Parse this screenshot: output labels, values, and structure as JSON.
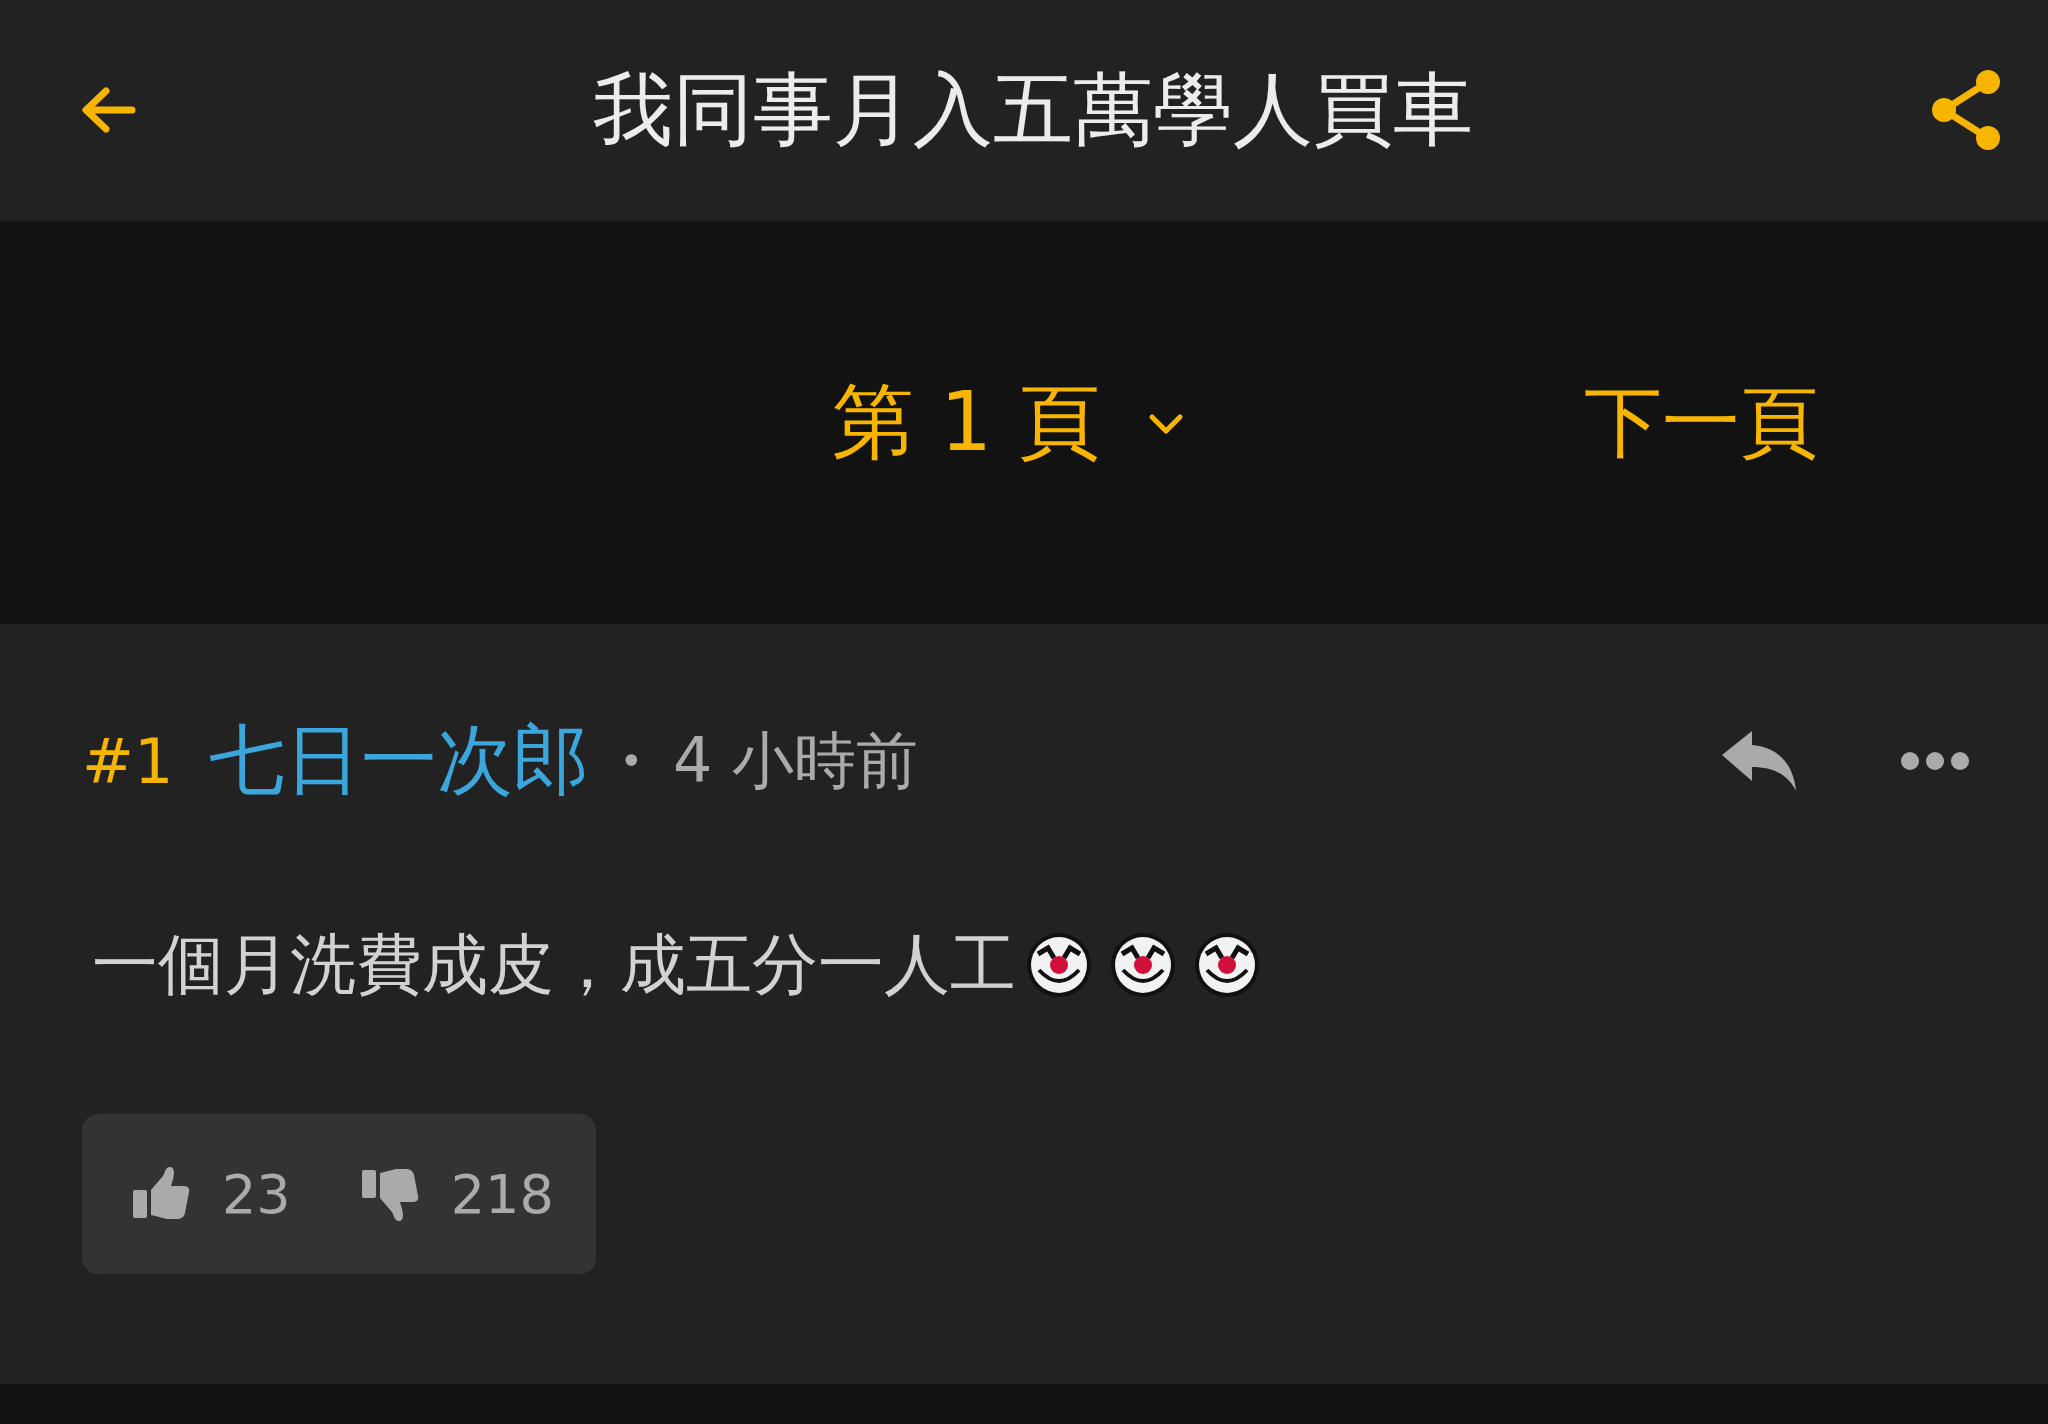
{
  "header": {
    "title": "我同事月入五萬學人買車"
  },
  "pagination": {
    "current_page": "第 1 頁",
    "next": "下一頁"
  },
  "post": {
    "number": "#1",
    "author": "七日一次郎",
    "separator": "•",
    "time": "4 小時前",
    "content": "一個月洗費成皮，成五分一人工",
    "emojis": [
      {
        "kind": "clown"
      },
      {
        "kind": "clown"
      },
      {
        "kind": "clown"
      }
    ],
    "likes": "23",
    "dislikes": "218"
  }
}
